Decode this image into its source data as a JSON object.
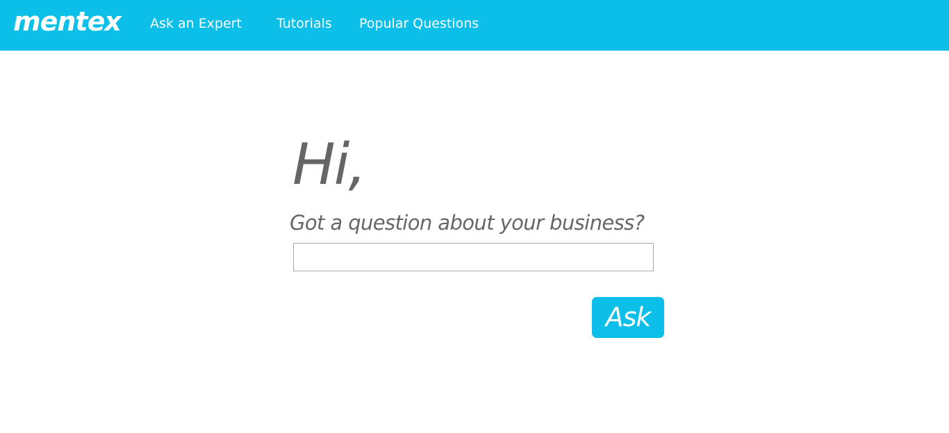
{
  "header": {
    "logo_text": "mentex",
    "nav": [
      {
        "label": "Ask an Expert"
      },
      {
        "label": "Tutorials"
      },
      {
        "label": "Popular Questions"
      }
    ],
    "background_color": "#0bbfe8"
  },
  "main": {
    "greeting": "Hi,",
    "prompt": "Got a question about your business?",
    "question_input": {
      "value": "",
      "placeholder": ""
    },
    "ask_button_label": "Ask"
  },
  "colors": {
    "accent": "#0bbfe8",
    "text_muted": "#666666",
    "input_border": "#a9a9a9"
  }
}
